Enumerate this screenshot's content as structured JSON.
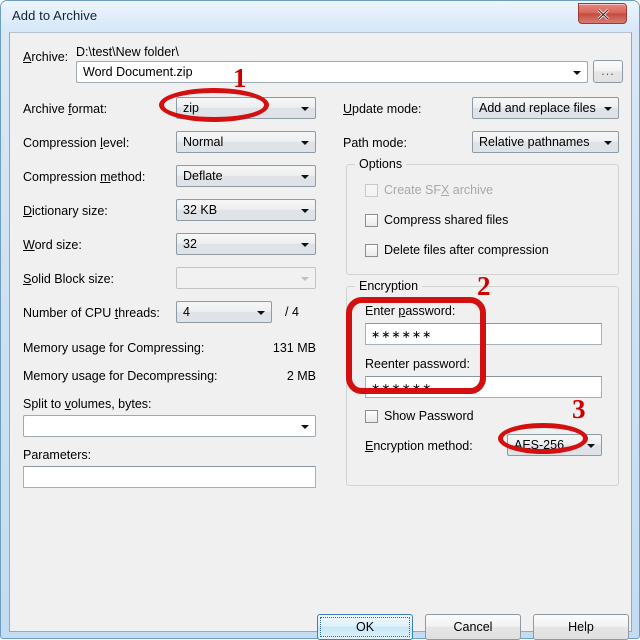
{
  "window": {
    "title": "Add to Archive",
    "close_icon": "close-icon"
  },
  "archive": {
    "label": "Archive:",
    "label_accel": "A",
    "path_text": "D:\\test\\New folder\\",
    "name_value": "Word Document.zip",
    "browse_label": "..."
  },
  "left_column": {
    "archive_format": {
      "label": "Archive format:",
      "value": "zip"
    },
    "compression_level": {
      "label": "Compression level:",
      "value": "Normal"
    },
    "compression_method": {
      "label": "Compression method:",
      "value": "Deflate"
    },
    "dictionary_size": {
      "label": "Dictionary size:",
      "value": "32 KB"
    },
    "word_size": {
      "label": "Word size:",
      "value": "32"
    },
    "solid_block_size": {
      "label": "Solid Block size:",
      "value": ""
    },
    "cpu_threads": {
      "label": "Number of CPU threads:",
      "value": "4",
      "total": "/ 4"
    },
    "memory_compress": {
      "label": "Memory usage for Compressing:",
      "value": "131 MB"
    },
    "memory_decompress": {
      "label": "Memory usage for Decompressing:",
      "value": "2 MB"
    },
    "split_volumes": {
      "label": "Split to volumes, bytes:",
      "value": ""
    },
    "parameters": {
      "label": "Parameters:",
      "value": ""
    }
  },
  "right_column": {
    "update_mode": {
      "label": "Update mode:",
      "value": "Add and replace files"
    },
    "path_mode": {
      "label": "Path mode:",
      "value": "Relative pathnames"
    },
    "options": {
      "title": "Options",
      "items": [
        {
          "label": "Create SFX archive",
          "checked": false,
          "disabled": true
        },
        {
          "label": "Compress shared files",
          "checked": false,
          "disabled": false
        },
        {
          "label": "Delete files after compression",
          "checked": false,
          "disabled": false
        }
      ]
    },
    "encryption": {
      "title": "Encryption",
      "enter_password_label": "Enter password:",
      "enter_password_value": "∗∗∗∗∗∗",
      "reenter_password_label": "Reenter password:",
      "reenter_password_value": "∗∗∗∗∗∗",
      "show_password_label": "Show Password",
      "show_password_checked": false,
      "encryption_method_label": "Encryption method:",
      "encryption_method_value": "AES-256"
    }
  },
  "buttons": {
    "ok": "OK",
    "cancel": "Cancel",
    "help": "Help"
  },
  "annotations": {
    "color": "#d40f0f",
    "marks": [
      {
        "number": "1",
        "target": "archive-format-combo"
      },
      {
        "number": "2",
        "target": "password-fields"
      },
      {
        "number": "3",
        "target": "encryption-method-combo"
      }
    ]
  }
}
